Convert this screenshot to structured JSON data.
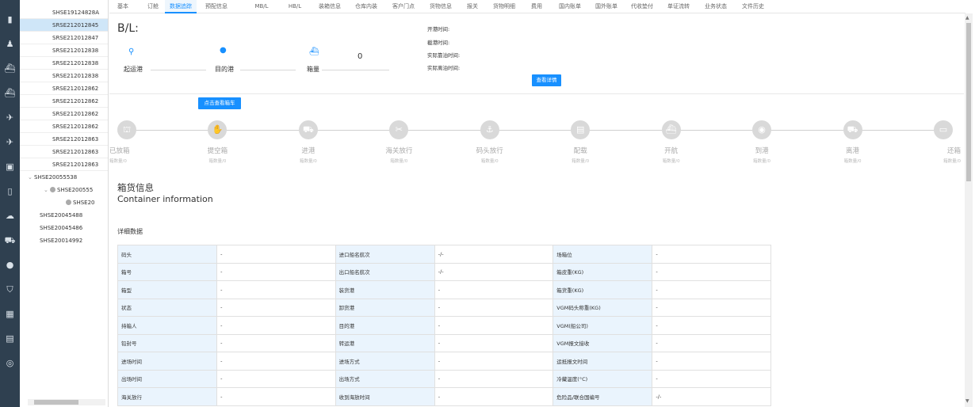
{
  "rail_icons": [
    "home-icon",
    "user-icon",
    "ship-icon",
    "ship-icon",
    "plane-icon",
    "plane-icon",
    "box-icon",
    "clipboard-icon",
    "cloud-icon",
    "truck-icon",
    "gear-icon",
    "shield-icon",
    "calendar-icon",
    "document-icon",
    "location-icon"
  ],
  "tree": {
    "rows": [
      {
        "label": "SHSE19124828A",
        "kind": "sub",
        "selected": false
      },
      {
        "label": "SRSE212012845",
        "kind": "sub",
        "selected": true
      },
      {
        "label": "SRSE212012847",
        "kind": "sub",
        "selected": false
      },
      {
        "label": "SRSE212012838",
        "kind": "sub",
        "selected": false
      },
      {
        "label": "SRSE212012838",
        "kind": "sub",
        "selected": false
      },
      {
        "label": "SRSE212012838",
        "kind": "sub",
        "selected": false
      },
      {
        "label": "SRSE212012862",
        "kind": "sub",
        "selected": false
      },
      {
        "label": "SRSE212012862",
        "kind": "sub",
        "selected": false
      },
      {
        "label": "SRSE212012862",
        "kind": "sub",
        "selected": false
      },
      {
        "label": "SRSE212012862",
        "kind": "sub",
        "selected": false
      },
      {
        "label": "SRSE212012863",
        "kind": "sub",
        "selected": false
      },
      {
        "label": "SRSE212012863",
        "kind": "sub",
        "selected": false
      },
      {
        "label": "SRSE212012863",
        "kind": "sub",
        "selected": false
      },
      {
        "label": "SHSE20055538",
        "kind": "group",
        "selected": false
      },
      {
        "label": "SHSE200555",
        "kind": "group2",
        "selected": false
      },
      {
        "label": "SHSE20",
        "kind": "leaf",
        "selected": false
      },
      {
        "label": "SHSE20045488",
        "kind": "top",
        "selected": false
      },
      {
        "label": "SHSE20045486",
        "kind": "top",
        "selected": false
      },
      {
        "label": "SHSE20014992",
        "kind": "top",
        "selected": false
      }
    ]
  },
  "tabs": [
    {
      "label": "基本",
      "active": false
    },
    {
      "label": "订舱",
      "active": false
    },
    {
      "label": "数据追踪",
      "active": true
    },
    {
      "label": "预配信息",
      "active": false
    },
    {
      "label": "MB/L",
      "active": false
    },
    {
      "label": "HB/L",
      "active": false
    },
    {
      "label": "装箱信息",
      "active": false
    },
    {
      "label": "仓库内装",
      "active": false
    },
    {
      "label": "客户门点",
      "active": false
    },
    {
      "label": "货物信息",
      "active": false
    },
    {
      "label": "报关",
      "active": false
    },
    {
      "label": "货物明细",
      "active": false
    },
    {
      "label": "费用",
      "active": false
    },
    {
      "label": "国内账单",
      "active": false
    },
    {
      "label": "国外账单",
      "active": false
    },
    {
      "label": "代收垫付",
      "active": false
    },
    {
      "label": "单证流转",
      "active": false
    },
    {
      "label": "业务状态",
      "active": false
    },
    {
      "label": "文件历史",
      "active": false
    }
  ],
  "header": {
    "bl_label": "B/L:",
    "origin_port": "起运港",
    "dest_port": "目的港",
    "box_count_label": "箱量",
    "box_count": "0",
    "times": [
      "开港时间:",
      "截港时间:",
      "实际靠泊时间:",
      "实际离泊时间:"
    ],
    "view_detail_button": "查看详情",
    "view_box_button": "点击查看箱车"
  },
  "timeline": [
    {
      "label": "已放箱",
      "sub": "箱数量/0",
      "icon": "crane-icon"
    },
    {
      "label": "提空箱",
      "sub": "箱数量/0",
      "icon": "hand-icon"
    },
    {
      "label": "进港",
      "sub": "箱数量/0",
      "icon": "truck-icon"
    },
    {
      "label": "海关放行",
      "sub": "箱数量/0",
      "icon": "stamp-icon"
    },
    {
      "label": "码头放行",
      "sub": "箱数量/0",
      "icon": "anchor-icon"
    },
    {
      "label": "配载",
      "sub": "箱数量/0",
      "icon": "document-icon"
    },
    {
      "label": "开航",
      "sub": "箱数量/0",
      "icon": "ship-icon"
    },
    {
      "label": "到港",
      "sub": "箱数量/0",
      "icon": "globe-icon"
    },
    {
      "label": "离港",
      "sub": "箱数量/0",
      "icon": "departure-truck-icon"
    },
    {
      "label": "还箱",
      "sub": "箱数量/0",
      "icon": "container-icon"
    }
  ],
  "container_info": {
    "title": "箱货信息",
    "subtitle": "Container information",
    "detail_title": "详细数据"
  },
  "detail_table": [
    [
      "码头",
      "-",
      "进口船名航次",
      "-/-",
      "场箱位",
      "-"
    ],
    [
      "箱号",
      "-",
      "出口船名航次",
      "-/-",
      "箱皮重(KG)",
      "-"
    ],
    [
      "箱型",
      "-",
      "装货港",
      "-",
      "箱货重(KG)",
      "-"
    ],
    [
      "状态",
      "-",
      "卸货港",
      "-",
      "VGM码头称重(KG)",
      "-"
    ],
    [
      "持箱人",
      "-",
      "目的港",
      "-",
      "VGM(船公司)",
      "-"
    ],
    [
      "铅封号",
      "-",
      "转运港",
      "-",
      "VGM报文接收",
      "-"
    ],
    [
      "进场时间",
      "-",
      "进场方式",
      "-",
      "运抵报文时间",
      "-"
    ],
    [
      "出场时间",
      "-",
      "出场方式",
      "-",
      "冷藏温度(°C)",
      "-"
    ],
    [
      "海关放行",
      "-",
      "收到海放时间",
      "-",
      "危险品/联合国编号",
      "-/-"
    ]
  ],
  "colors": {
    "accent": "#1890ff",
    "rail_bg": "#2f4050",
    "selected_row": "#cfe6f8",
    "table_key_bg": "#eaf4fd",
    "timeline_gray": "#d9d9d9"
  }
}
